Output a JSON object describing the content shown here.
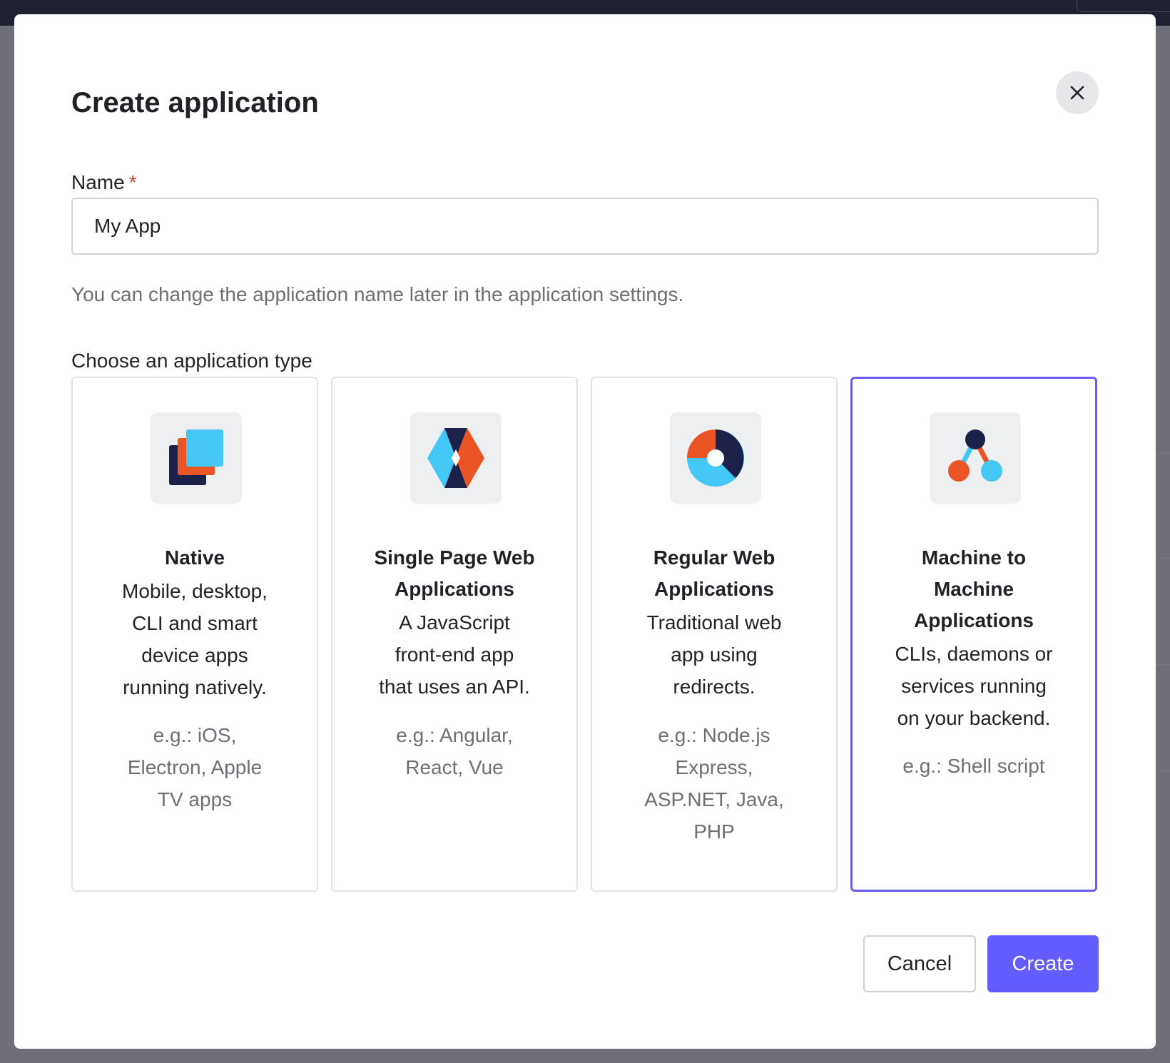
{
  "dialog": {
    "title": "Create application",
    "close_icon": "close-icon"
  },
  "name_field": {
    "label": "Name",
    "required_mark": "*",
    "value": "My App",
    "hint": "You can change the application name later in the application settings."
  },
  "app_type": {
    "heading": "Choose an application type",
    "selected": "Machine to Machine Applications",
    "cards": [
      {
        "icon": "native-icon",
        "title": [
          "Native"
        ],
        "description": [
          "Mobile, desktop,",
          "CLI and smart",
          "device apps",
          "running natively."
        ],
        "examples": [
          "e.g.: iOS,",
          "Electron, Apple",
          "TV apps"
        ]
      },
      {
        "icon": "spa-icon",
        "title": [
          "Single Page Web",
          "Applications"
        ],
        "description": [
          "A JavaScript",
          "front-end app",
          "that uses an API."
        ],
        "examples": [
          "e.g.: Angular,",
          "React, Vue"
        ]
      },
      {
        "icon": "regular-web-icon",
        "title": [
          "Regular Web",
          "Applications"
        ],
        "description": [
          "Traditional web",
          "app using",
          "redirects."
        ],
        "examples": [
          "e.g.: Node.js",
          "Express,",
          "ASP.NET, Java,",
          "PHP"
        ]
      },
      {
        "icon": "m2m-icon",
        "title": [
          "Machine to",
          "Machine",
          "Applications"
        ],
        "description": [
          "CLIs, daemons or",
          "services running",
          "on your backend."
        ],
        "examples": [
          "e.g.: Shell script"
        ]
      }
    ]
  },
  "actions": {
    "cancel": "Cancel",
    "create": "Create"
  },
  "colors": {
    "accent": "#635dff",
    "selected_border": "#6a5cf0",
    "required": "#d03a2f",
    "navy": "#1b2148",
    "orange": "#eb5424",
    "sky": "#44c7f4"
  }
}
